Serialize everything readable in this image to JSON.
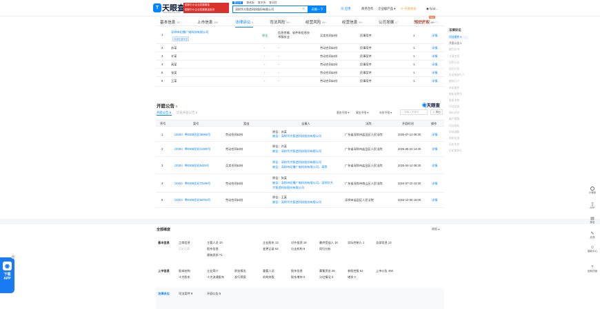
{
  "header": {
    "logo": "天眼查",
    "logo_sub": "TianYanCha.com",
    "banner": [
      "国家中小企业发展基金",
      "国家中小企业发展基金投资"
    ],
    "search_tabs": [
      "查公司",
      "查老板",
      "查关系",
      "查风险"
    ],
    "search_value": "深圳华大智造科技股份有限公司",
    "search_button": "天眼一下",
    "nav": [
      "应用",
      "商务合作",
      "企业级产品",
      "开通会员",
      "fyo4..."
    ]
  },
  "tabs": [
    {
      "label": "基本信息",
      "count": "207"
    },
    {
      "label": "上市信息",
      "count": "350"
    },
    {
      "label": "法律诉讼",
      "count": "9"
    },
    {
      "label": "司法风险",
      "count": "99+"
    },
    {
      "label": "经营风险",
      "count": "99+"
    },
    {
      "label": "经营信息",
      "count": "99+"
    },
    {
      "label": "公司发展",
      "count": "47"
    },
    {
      "label": "知识产权",
      "count": "99+"
    },
    {
      "label": "历史信息",
      "count": "99+"
    }
  ],
  "case_rows": [
    {
      "no": "1",
      "name": "深圳市纪播广电科技有限公司",
      "sub": "存续在营状态",
      "role": "原告",
      "desc": "信息传输、软件和信息技术服务业",
      "type": "买卖合同纠纷",
      "ctype": "民事案件",
      "n": "1",
      "op": "详情"
    },
    {
      "no": "2",
      "name": "苏某",
      "role": "-",
      "desc": "-",
      "type": "劳动合同纠纷",
      "ctype": "民事案件",
      "n": "1",
      "op": "详情"
    },
    {
      "no": "3",
      "name": "许某",
      "role": "-",
      "desc": "-",
      "type": "劳动合同纠纷",
      "ctype": "民事案件",
      "n": "1",
      "op": "详情"
    },
    {
      "no": "4",
      "name": "高某",
      "role": "-",
      "desc": "-",
      "type": "劳动合同纠纷",
      "ctype": "民事案件",
      "n": "1",
      "op": "详情"
    },
    {
      "no": "5",
      "name": "张某",
      "role": "-",
      "desc": "-",
      "type": "劳动合同纠纷",
      "ctype": "民事案件",
      "n": "1",
      "op": "详情"
    },
    {
      "no": "6",
      "name": "王某",
      "role": "-",
      "desc": "-",
      "type": "劳动合同纠纷",
      "ctype": "民事案件",
      "n": "1",
      "op": "详情"
    }
  ],
  "notice": {
    "title": "开庭公告",
    "count": "5",
    "brand": "天眼查",
    "subtabs": [
      "开庭公告 5",
      "历史开庭公告 5"
    ],
    "filters": [
      "案由不限",
      "案由不限",
      "年份不限"
    ],
    "search_ph": "请输入关键字",
    "export": "导出",
    "headers": [
      "序号",
      "案号",
      "案由",
      "当事人",
      "法院",
      "开庭时间",
      "操作"
    ],
    "rows": [
      {
        "no": "1",
        "case": "（2025）粤0308民初36960号",
        "reason": "劳动合同纠纷",
        "p1": "原告：苏某",
        "p2": "被告：深圳华大智造科技股份有限公司",
        "p3": "",
        "court": "广东省深圳市盐田区人民法院",
        "time": "2025-07-14 09:30",
        "op": "详情"
      },
      {
        "no": "2",
        "case": "（2025）粤0308民初21960号",
        "reason": "劳动合同纠纷",
        "p1": "原告：许某",
        "p2": "被告：深圳华大智造科技股份有限公司",
        "p3": "",
        "court": "广东省深圳市盐田区人民法院",
        "time": "2025-06-23 14:30",
        "op": "详情"
      },
      {
        "no": "3",
        "case": "（2025）粤0308民初9449号",
        "reason": "买卖合同纠纷",
        "p1": "原告：深圳华大智造科技股份有限公司",
        "p2": "被告：深圳市纪播广电科技有限公司，高等",
        "p3": "",
        "court": "广东省深圳市盐田区人民法院",
        "time": "2025-04-14 09:30",
        "op": "详情"
      },
      {
        "no": "4",
        "case": "（2024）粤0308民初73289号",
        "reason": "劳动合同纠纷",
        "p1": "原告：张某",
        "p2": "被告：深圳市纪播广电科技有限公司，深圳华大",
        "p3": "大智造科技股份有限公司",
        "court": "广东省深圳市南山区人民法院",
        "time": "2024-07-10 10:30",
        "op": "详情"
      },
      {
        "no": "5",
        "case": "（2023）粤0308民初55784号",
        "reason": "劳动合同纠纷",
        "p1": "原告：王某",
        "p2": "被告：深圳华大智造科技股份有限公司",
        "p3": "",
        "court": "深圳市盐田区人民法院",
        "time": "2023-12-06 16:00",
        "op": "详情"
      }
    ]
  },
  "dims": {
    "title": "全部维度",
    "collapse": "收起",
    "groups": [
      {
        "label": "基本信息",
        "rows": [
          [
            "工商信息",
            "主要人员 10",
            "企业股东 13",
            "对外投资 16",
            "最终受益人 16",
            "实际控制人 1",
            "总部信息 13"
          ],
          [
            "历史沿革",
            "股东信息",
            "变更记录 53",
            "分支机构 8",
            "同行分析",
            "",
            ""
          ],
          [
            "",
            "建筑资质 71",
            "",
            "",
            "",
            "",
            ""
          ]
        ]
      },
      {
        "label": "上市信息",
        "rows": [
          [
            "股本结构",
            "企业简介",
            "财务报告",
            "重要人员",
            "股东信息",
            "募集资金 26",
            "参股控股 61",
            "上市公告 450"
          ],
          [
            "十大股东",
            "十大流通股东",
            "发行预案",
            "机构持股",
            "股东增持 0",
            "分红情况 3",
            "增发 0",
            ""
          ]
        ]
      },
      {
        "label": "法律诉讼",
        "rows": [
          [
            "司法案件 9",
            "开庭公告 5",
            "",
            "",
            "",
            "",
            "",
            ""
          ],
          [
            "",
            "",
            "",
            "",
            "",
            "",
            "",
            ""
          ]
        ]
      }
    ]
  },
  "right_menu": {
    "title": "法律诉讼",
    "items": [
      "司法案件 9",
      "开庭公告 5",
      "裁判文书",
      "立案信息",
      "法院公告",
      "送达公告",
      "失信被执行人",
      "被执行人",
      "终本案件",
      "限制消费令",
      "股权冻结",
      "司法拍卖",
      "询价评估",
      "破产重整",
      "司法协助",
      "诉前调解",
      "限制出境",
      "历史失信",
      "历史被执行"
    ]
  },
  "far_tools": [
    "小程序",
    "APP",
    "报名",
    "反馈",
    "智能中心",
    "回到顶部"
  ],
  "float_ad": "下载APP"
}
